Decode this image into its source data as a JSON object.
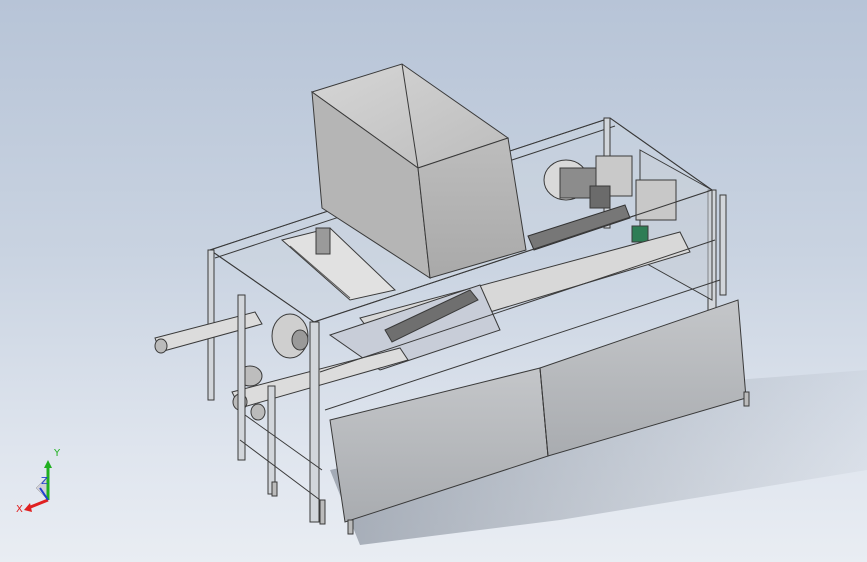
{
  "triad": {
    "x_label": "X",
    "y_label": "Y",
    "z_label": "Z"
  },
  "colors": {
    "x_axis": "#e02020",
    "y_axis": "#20b020",
    "z_axis": "#2040d0",
    "frame": "#c9cdd3",
    "panel": "#b9bcc0",
    "hopper": "#c7c7c7",
    "accent_green": "#2e7d55"
  },
  "icons": {
    "triad": "reference-triad-icon",
    "motor": "motor-icon"
  }
}
